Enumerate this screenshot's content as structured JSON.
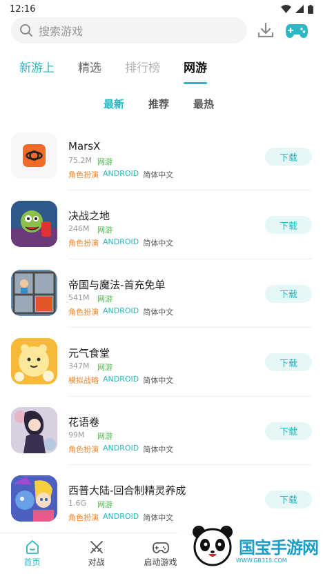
{
  "status": {
    "time": "12:16"
  },
  "search": {
    "placeholder": "搜索游戏"
  },
  "tabs": [
    {
      "label": "新游上"
    },
    {
      "label": "精选"
    },
    {
      "label": "排行榜"
    },
    {
      "label": "网游"
    }
  ],
  "subtabs": [
    {
      "label": "最新"
    },
    {
      "label": "推荐"
    },
    {
      "label": "最热"
    }
  ],
  "games": [
    {
      "name": "MarsX",
      "size": "75.2M",
      "category": "网游",
      "genre": "角色扮演",
      "platform": "ANDROID",
      "lang": "简体中文",
      "button": "下载"
    },
    {
      "name": "决战之地",
      "size": "246M",
      "category": "网游",
      "genre": "角色扮演",
      "platform": "ANDROID",
      "lang": "简体中文",
      "button": "下载"
    },
    {
      "name": "帝国与魔法-首充免单",
      "size": "541M",
      "category": "网游",
      "genre": "角色扮演",
      "platform": "ANDROID",
      "lang": "简体中文",
      "button": "下载"
    },
    {
      "name": "元气食堂",
      "size": "347M",
      "category": "网游",
      "genre": "模拟战略",
      "platform": "ANDROID",
      "lang": "简体中文",
      "button": "下载"
    },
    {
      "name": "花语卷",
      "size": "99M",
      "category": "网游",
      "genre": "角色扮演",
      "platform": "ANDROID",
      "lang": "简体中文",
      "button": "下载"
    },
    {
      "name": "西普大陆-回合制精灵养成",
      "size": "1.6G",
      "category": "网游",
      "genre": "角色扮演",
      "platform": "ANDROID",
      "lang": "简体中文",
      "button": "下载"
    }
  ],
  "bottom_nav": [
    {
      "label": "首页"
    },
    {
      "label": "对战"
    },
    {
      "label": "启动游戏"
    }
  ],
  "watermark": {
    "text": "国宝手游网",
    "url": "WWW.GB315.COM"
  }
}
